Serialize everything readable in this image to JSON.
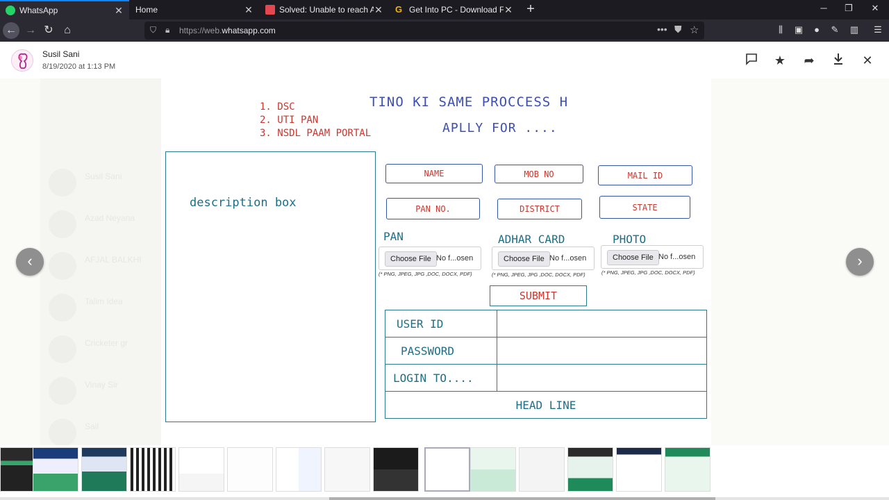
{
  "browser": {
    "tabs": [
      {
        "label": "WhatsApp",
        "favicon_color": "#25d366"
      },
      {
        "label": "Home",
        "favicon_color": ""
      },
      {
        "label": "Solved: Unable to reach Adobe",
        "favicon_color": "#e34850"
      },
      {
        "label": "Get Into PC - Download Free Yo",
        "favicon_color": "#f4b400"
      }
    ],
    "url_prefix": "https://web.",
    "url_domain": "whatsapp.com",
    "icons": [
      "back-icon",
      "forward-icon",
      "reload-icon",
      "home-icon",
      "shield-icon",
      "lock-icon",
      "more-icon",
      "pocket-icon",
      "bookmark-star-icon",
      "library-icon",
      "sidebar-icon",
      "profile-icon",
      "extension-icon",
      "container-icon",
      "menu-icon"
    ]
  },
  "viewer": {
    "sender_name": "Susil Sani",
    "timestamp": "8/19/2020 at 1:13 PM",
    "actions": [
      "comment-icon",
      "star-icon",
      "forward-icon",
      "download-icon",
      "close-icon"
    ]
  },
  "background_chats": [
    {
      "name": "Susil Sani",
      "sub": ""
    },
    {
      "name": "Azad Neyana",
      "sub": ""
    },
    {
      "name": "AFJAL BALKHI",
      "sub": ""
    },
    {
      "name": "Talim Idea",
      "sub": ""
    },
    {
      "name": "Cricketer gr",
      "sub": ""
    },
    {
      "name": "Vinay Sir",
      "sub": ""
    },
    {
      "name": "Sail",
      "sub": ""
    }
  ],
  "sketch": {
    "list": [
      "1. DSC",
      "2. UTI PAN",
      "3. NSDL PAAM PORTAL"
    ],
    "title_line1": "TINO KI SAME PROCCESS H",
    "title_line2": "APLLY FOR ....",
    "description_label": "description box",
    "fields": {
      "name": "NAME",
      "mob": "MOB NO",
      "mail": "MAIL ID",
      "pan": "PAN NO.",
      "district": "DISTRICT",
      "state": "STATE"
    },
    "uploads": [
      {
        "label": "PAN",
        "button": "Choose File",
        "status": "No f...osen",
        "hint": "(* PNG, JPEG, JPG ,DOC, DOCX, PDF)"
      },
      {
        "label": "ADHAR CARD",
        "button": "Choose File",
        "status": "No f...osen",
        "hint": "(* PNG, JPEG, JPG ,DOC, DOCX, PDF)"
      },
      {
        "label": "PHOTO",
        "button": "Choose File",
        "status": "No f...osen",
        "hint": "(* PNG, JPEG, JPG ,DOC, DOCX, PDF)"
      }
    ],
    "submit": "SUBMIT",
    "login": {
      "user_id": "USER ID",
      "password": "PASSWORD",
      "login_to": "LOGIN TO....",
      "headline": "HEAD LINE"
    }
  },
  "thumbnail_count": 15
}
